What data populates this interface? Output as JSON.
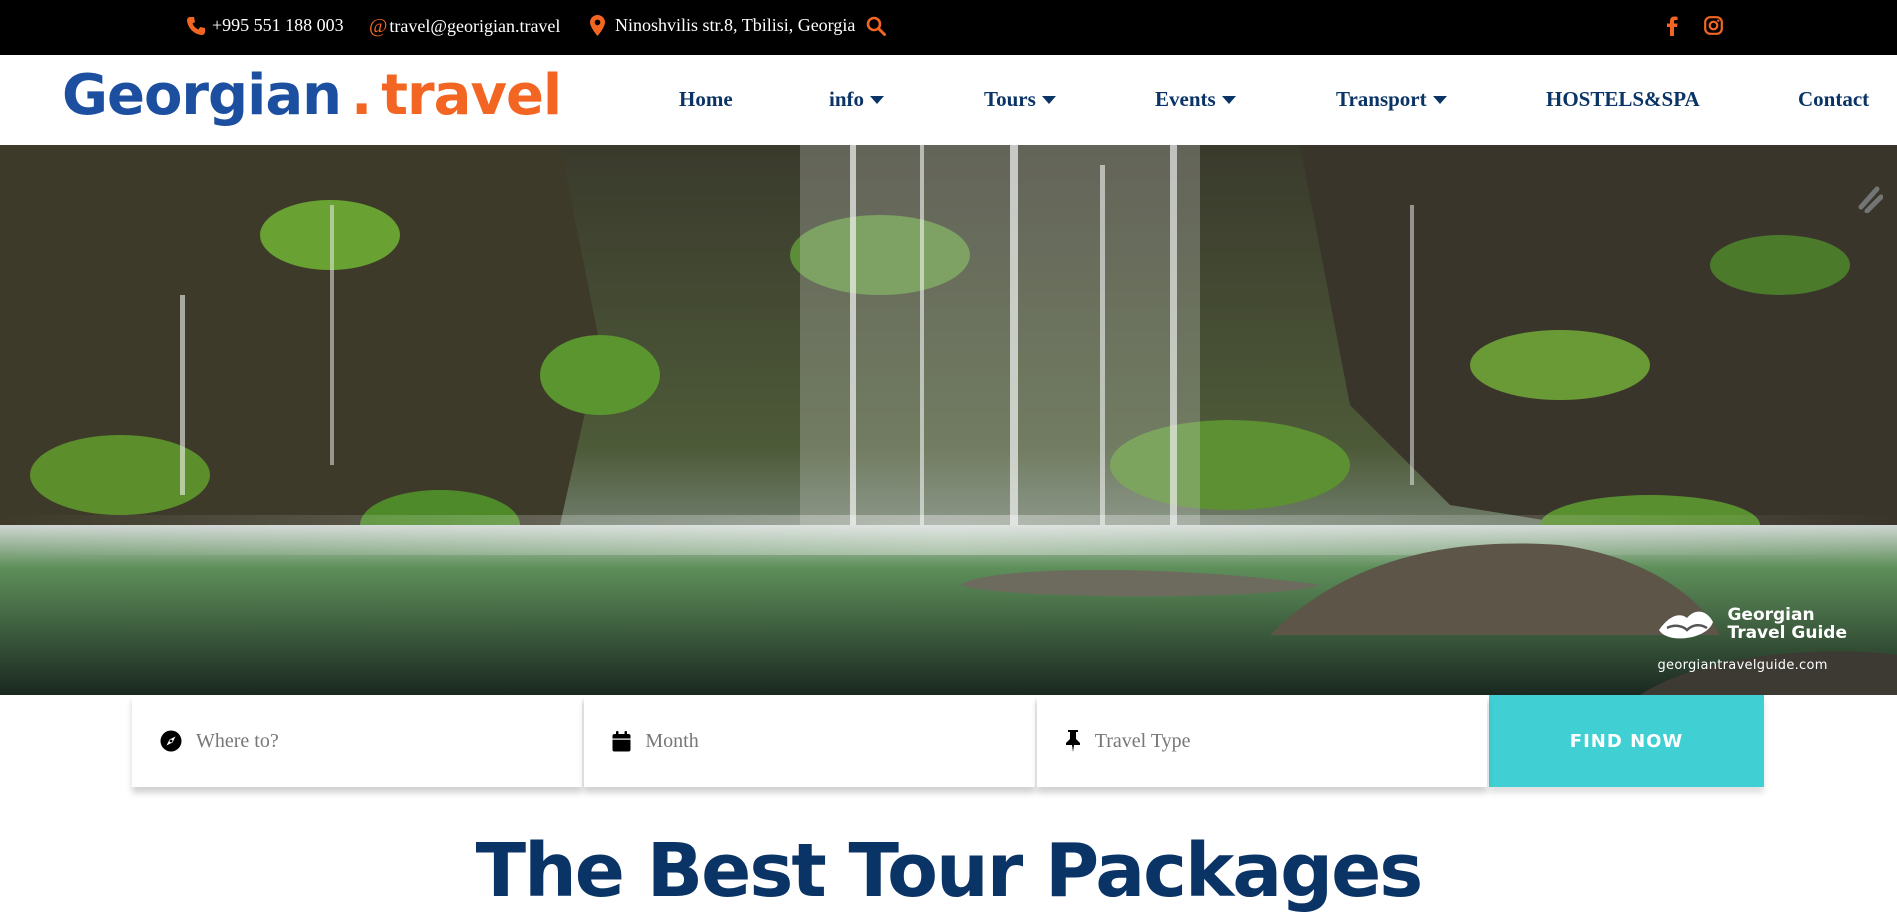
{
  "topbar": {
    "phone": "+995 551 188 003",
    "email": "travel@georigian.travel",
    "address": "Ninoshvilis str.8, Tbilisi, Georgia",
    "icons": [
      "phone-icon",
      "at-icon",
      "map-marker-icon",
      "search-icon",
      "facebook-icon",
      "instagram-icon"
    ],
    "accent": "#f26522"
  },
  "logo": {
    "part1": "Georgian",
    "dot": ".",
    "part2": "travel",
    "blue": "#1d4fa0",
    "orange": "#f26522"
  },
  "nav": {
    "items": [
      {
        "label": "Home",
        "dropdown": false
      },
      {
        "label": "info",
        "dropdown": true
      },
      {
        "label": "Tours",
        "dropdown": true
      },
      {
        "label": "Events",
        "dropdown": true
      },
      {
        "label": "Transport",
        "dropdown": true
      },
      {
        "label": "HOSTELS&SPA",
        "dropdown": false
      },
      {
        "label": "Contact",
        "dropdown": false
      }
    ],
    "color": "#0b3466"
  },
  "hero": {
    "watermark_brand_line1": "Georgian",
    "watermark_brand_line2": "Travel Guide",
    "watermark_url": "georgiantravelguide.com"
  },
  "search": {
    "where_placeholder": "Where to?",
    "month_placeholder": "Month",
    "type_placeholder": "Travel Type",
    "button_label": "FIND NOW",
    "button_color": "#40cfd2",
    "icons": [
      "compass-icon",
      "calendar-icon",
      "pushpin-icon"
    ]
  },
  "section": {
    "title": "The Best Tour Packages"
  }
}
